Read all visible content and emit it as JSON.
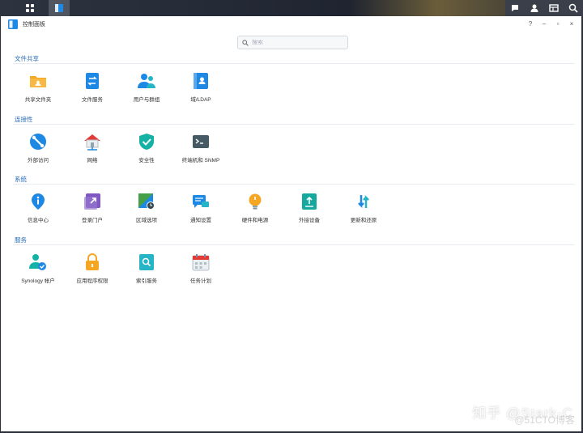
{
  "window": {
    "title": "控制面板"
  },
  "search": {
    "placeholder": "搜索"
  },
  "window_controls": {
    "help": "?",
    "minimize": "–",
    "restore": "▫",
    "close": "×"
  },
  "sections": [
    {
      "title": "文件共享",
      "items": [
        {
          "label": "共享文件夹",
          "icon": "shared-folder-icon"
        },
        {
          "label": "文件服务",
          "icon": "file-services-icon"
        },
        {
          "label": "用户与群组",
          "icon": "user-group-icon"
        },
        {
          "label": "域/LDAP",
          "icon": "domain-ldap-icon"
        }
      ]
    },
    {
      "title": "连接性",
      "items": [
        {
          "label": "外部访问",
          "icon": "external-access-icon"
        },
        {
          "label": "网络",
          "icon": "network-icon"
        },
        {
          "label": "安全性",
          "icon": "security-shield-icon"
        },
        {
          "label": "终端机和 SNMP",
          "icon": "terminal-icon"
        }
      ]
    },
    {
      "title": "系统",
      "items": [
        {
          "label": "信息中心",
          "icon": "info-center-icon"
        },
        {
          "label": "登录门户",
          "icon": "login-portal-icon"
        },
        {
          "label": "区域选项",
          "icon": "regional-options-icon"
        },
        {
          "label": "通知设置",
          "icon": "notification-icon"
        },
        {
          "label": "硬件和电源",
          "icon": "hardware-power-icon"
        },
        {
          "label": "外接设备",
          "icon": "external-devices-icon"
        },
        {
          "label": "更新和还原",
          "icon": "update-restore-icon"
        }
      ]
    },
    {
      "title": "服务",
      "items": [
        {
          "label": "Synology 帐户",
          "icon": "synology-account-icon"
        },
        {
          "label": "应用程序权限",
          "icon": "app-privileges-icon"
        },
        {
          "label": "索引服务",
          "icon": "indexing-service-icon"
        },
        {
          "label": "任务计划",
          "icon": "task-scheduler-icon"
        }
      ]
    }
  ],
  "watermark": {
    "main": "知乎 @Stark-C",
    "sub": "@51CTO博客"
  },
  "colors": {
    "accent": "#2a6db7",
    "orange": "#f5a623",
    "blue": "#1e88e5",
    "teal": "#26b5c6"
  }
}
